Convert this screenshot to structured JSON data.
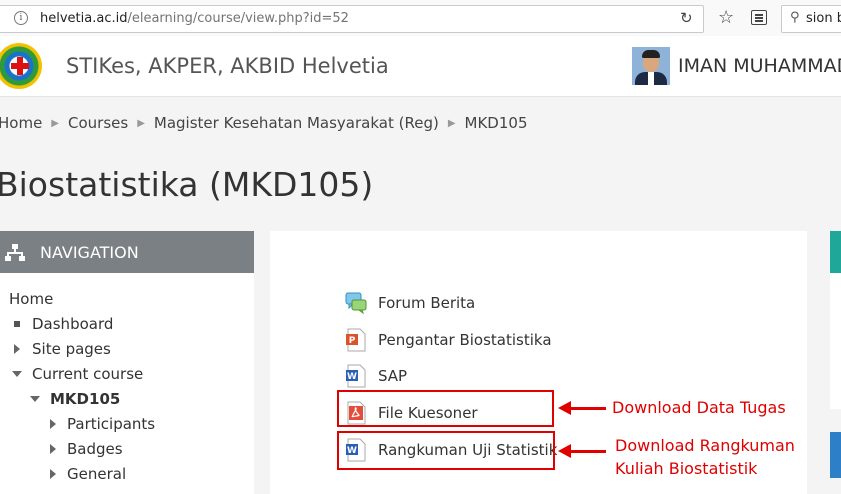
{
  "browser": {
    "url_host": "helvetia.ac.id",
    "url_path": "/elearning/course/view.php?id=52",
    "search_text": "sion b"
  },
  "header": {
    "site_name": "STIKes, AKPER, AKBID Helvetia",
    "user_name": "IMAN MUHAMMAD"
  },
  "breadcrumb": [
    "Home",
    "Courses",
    "Magister Kesehatan Masyarakat (Reg)",
    "MKD105"
  ],
  "page_title": "Biostatistika (MKD105)",
  "navigation": {
    "title": "NAVIGATION",
    "items": [
      {
        "label": "Home"
      },
      {
        "label": "Dashboard"
      },
      {
        "label": "Site pages"
      },
      {
        "label": "Current course"
      },
      {
        "label": "MKD105"
      },
      {
        "label": "Participants"
      },
      {
        "label": "Badges"
      },
      {
        "label": "General"
      }
    ]
  },
  "activities": [
    {
      "label": "Forum Berita",
      "icon": "forum-icon"
    },
    {
      "label": "Pengantar Biostatistika",
      "icon": "powerpoint-icon"
    },
    {
      "label": "SAP",
      "icon": "word-icon"
    },
    {
      "label": "File Kuesoner",
      "icon": "pdf-icon"
    },
    {
      "label": "Rangkuman Uji Statistik",
      "icon": "word-icon"
    }
  ],
  "annotations": {
    "note_1": "Download Data Tugas",
    "note_2_line1": "Download Rangkuman",
    "note_2_line2": "Kuliah Biostatistik",
    "color": "#e00000"
  },
  "colors": {
    "nav_header": "#7b8084",
    "teal_block": "#1fa89a",
    "blue_block": "#2d7fc7"
  }
}
